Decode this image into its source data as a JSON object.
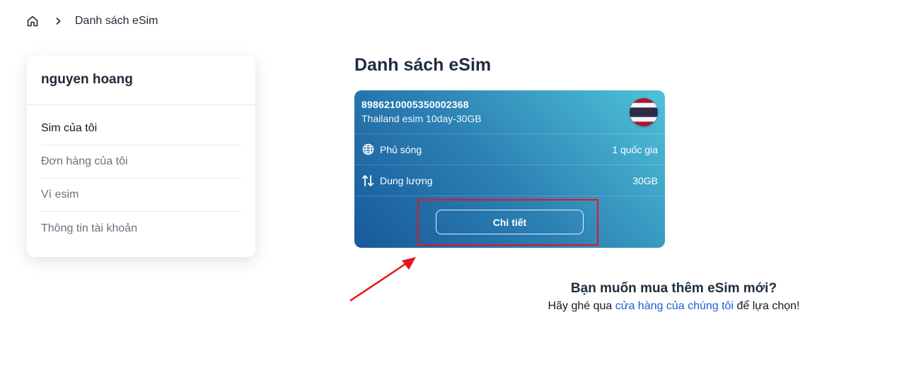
{
  "breadcrumb": {
    "home_icon": "home-icon",
    "separator_icon": "chevron-right-icon",
    "current": "Danh sách eSim"
  },
  "sidebar": {
    "user_name": "nguyen hoang",
    "items": [
      {
        "label": "Sim của tôi",
        "active": true
      },
      {
        "label": "Đơn hàng của tôi",
        "active": false
      },
      {
        "label": "Ví esim",
        "active": false
      },
      {
        "label": "Thông tin tài khoản",
        "active": false
      }
    ]
  },
  "main": {
    "title": "Danh sách eSim",
    "esim_card": {
      "iccid": "8986210005350002368",
      "plan_name": "Thailand esim 10day-30GB",
      "flag_icon": "thailand-flag-icon",
      "rows": [
        {
          "icon": "globe-icon",
          "label": "Phủ sóng",
          "value": "1 quốc gia"
        },
        {
          "icon": "data-transfer-icon",
          "label": "Dung lượng",
          "value": "30GB"
        }
      ],
      "detail_button": "Chi tiết"
    }
  },
  "promo": {
    "title": "Bạn muốn mua thêm eSim mới?",
    "text_before": "Hãy ghé qua ",
    "link": "cửa hàng của chúng tôi",
    "text_after": " để lựa chọn!"
  },
  "colors": {
    "card_gradient_start": "#17599a",
    "card_gradient_end": "#4fc3d8",
    "link": "#1d5fd6",
    "annotation": "#e5161b"
  }
}
